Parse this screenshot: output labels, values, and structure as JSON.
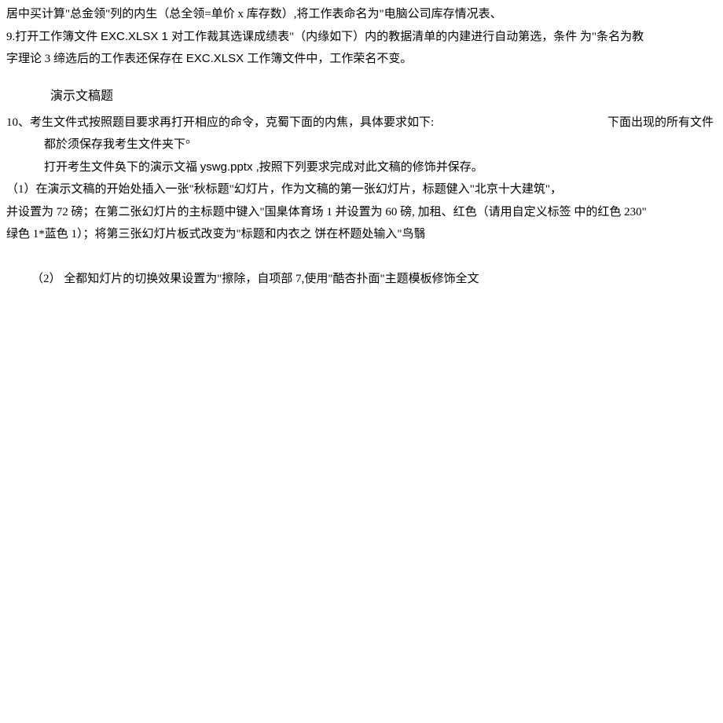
{
  "lines": {
    "l1": "居中买计算\"总金领\"列的内生（总全领=单价 x 库存数）,将工作表命名为\"电脑公司库存情况表、",
    "l2a": "9.打开工作簿文件 ",
    "l2b": "EXC.XLSX 1 ",
    "l2c": "对工作裁其选课成绩表\"（内缘如下）内的教据清单的内建进行自动第选，条件  为\"条名为教",
    "l3a": "字理论 3 缔选后的工作表还保存在 ",
    "l3b": "EXC.XLSX ",
    "l3c": "工作簿文件中，工作荣名不变。",
    "section": "演示文稿题",
    "l5a": "10、考生文件式按照题目要求再打开相应的命令，克蜀下面的内焦，具体要求如下:",
    "l5b": "下面出现的所有文件",
    "l6": "都於须保存我考生文件夹下°",
    "l7a": "打开考生文件奂下的演示文福 ",
    "l7b": "yswg.pptx ,",
    "l7c": "按照下列要求完成对此文稿的修饰并保存。",
    "l8": "（1）在演示文稿的开始处插入一张\"秋标题\"幻灯片，作为文稿的第一张幻灯片，标题健入\"北京十大建筑\"，",
    "l9": "并设置为 72 磅；在第二张幻灯片的主标题中键入\"国臬体育场 1 并设置为 60 磅, 加租、红色（请用自定义标签  中的红色 230\"",
    "l10": "绿色 1*蓝色 1）；将第三张幻灯片板式改变为\"标题和内衣之  饼在杯题处输入\"鸟翳",
    "l11": " （2） 全都知灯片的切换效果设置为\"擦除，自项部 7,使用\"酷杏扑面\"主题模板修饰全文"
  }
}
